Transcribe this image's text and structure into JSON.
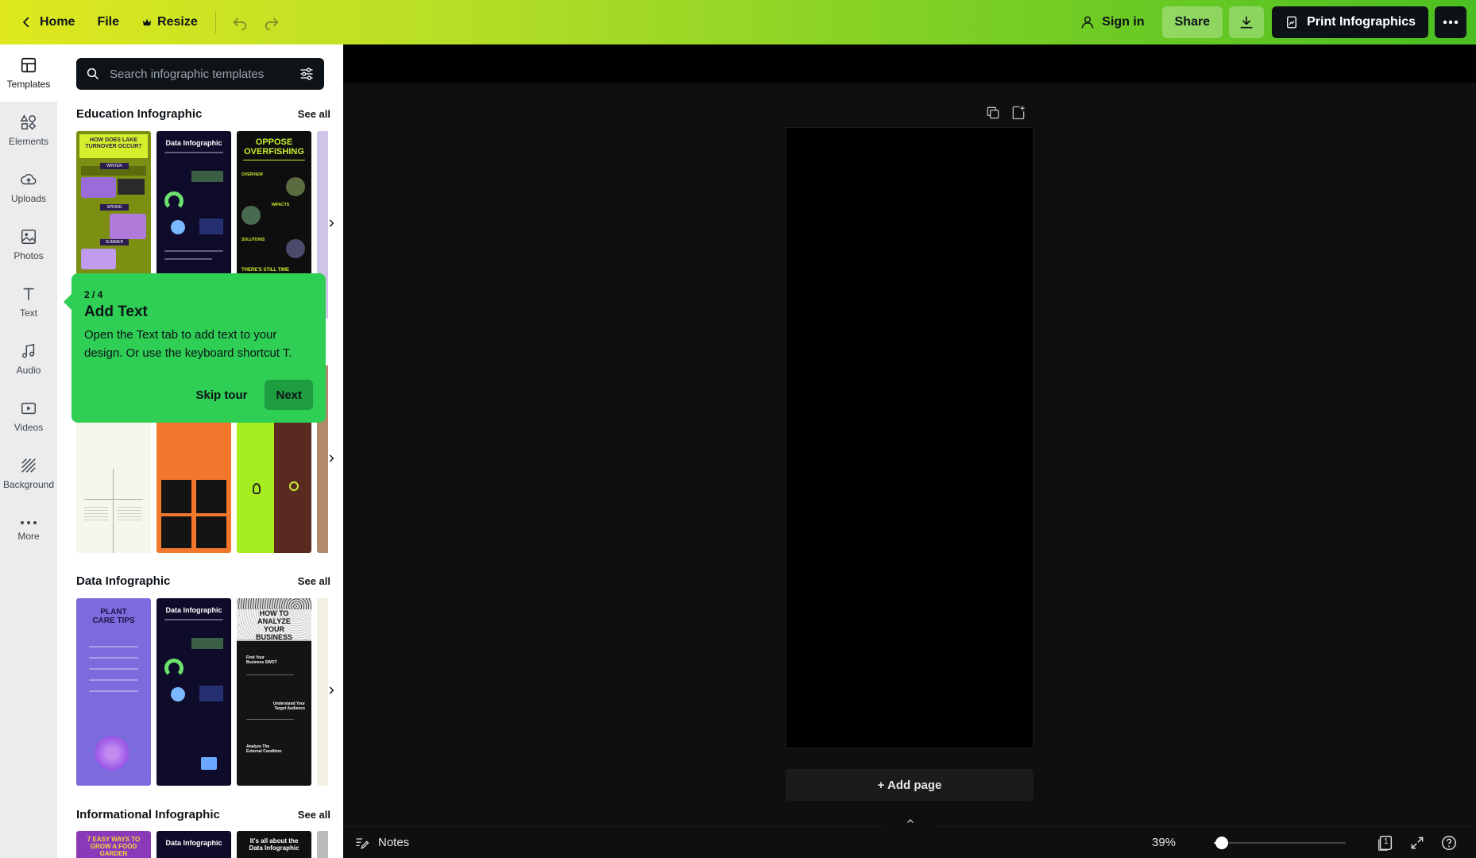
{
  "topbar": {
    "home_label": "Home",
    "file_label": "File",
    "resize_label": "Resize",
    "sign_in_label": "Sign in",
    "share_label": "Share",
    "print_label": "Print Infographics"
  },
  "rail": {
    "items": [
      {
        "label": "Templates"
      },
      {
        "label": "Elements"
      },
      {
        "label": "Uploads"
      },
      {
        "label": "Photos"
      },
      {
        "label": "Text"
      },
      {
        "label": "Audio"
      },
      {
        "label": "Videos"
      },
      {
        "label": "Background"
      },
      {
        "label": "More"
      }
    ]
  },
  "panel": {
    "search_placeholder": "Search infographic templates",
    "sections": [
      {
        "title": "Education Infographic",
        "see_all": "See all"
      },
      {
        "title": "",
        "see_all": ""
      },
      {
        "title": "Data Infographic",
        "see_all": "See all"
      },
      {
        "title": "Informational Infographic",
        "see_all": "See all"
      }
    ],
    "thumbs": {
      "edu1": "HOW DOES LAKE TURNOVER OCCUR?",
      "edu1_labels": [
        "WINTER",
        "SPRING",
        "SUMMER"
      ],
      "edu2": "Data Infographic",
      "edu3": "OPPOSE OVERFISHING",
      "edu3_labels": [
        "OVERVIEW",
        "IMPACTS",
        "SOLUTIONS",
        "THERE'S STILL TIME"
      ],
      "data1": "PLANT CARE TIPS",
      "data2": "Data Infographic",
      "data3": "HOW TO ANALYZE YOUR BUSINESS",
      "data3_labels": [
        "Find Your Business SWOT",
        "Understand Your Target Audience",
        "Analyze The External Condition"
      ],
      "info1": "7 EASY WAYS TO GROW A FOOD GARDEN",
      "info2": "Data Infographic",
      "info3": "It's all about the Data Infographic"
    }
  },
  "tour": {
    "step": "2 / 4",
    "title": "Add Text",
    "body": "Open the Text tab to add text to your design. Or use the keyboard shortcut T.",
    "skip_label": "Skip tour",
    "next_label": "Next"
  },
  "canvas": {
    "add_page_label": "+ Add page"
  },
  "bottombar": {
    "notes_label": "Notes",
    "zoom_label": "39%",
    "zoom_value": 0.39,
    "page_count": "1"
  }
}
